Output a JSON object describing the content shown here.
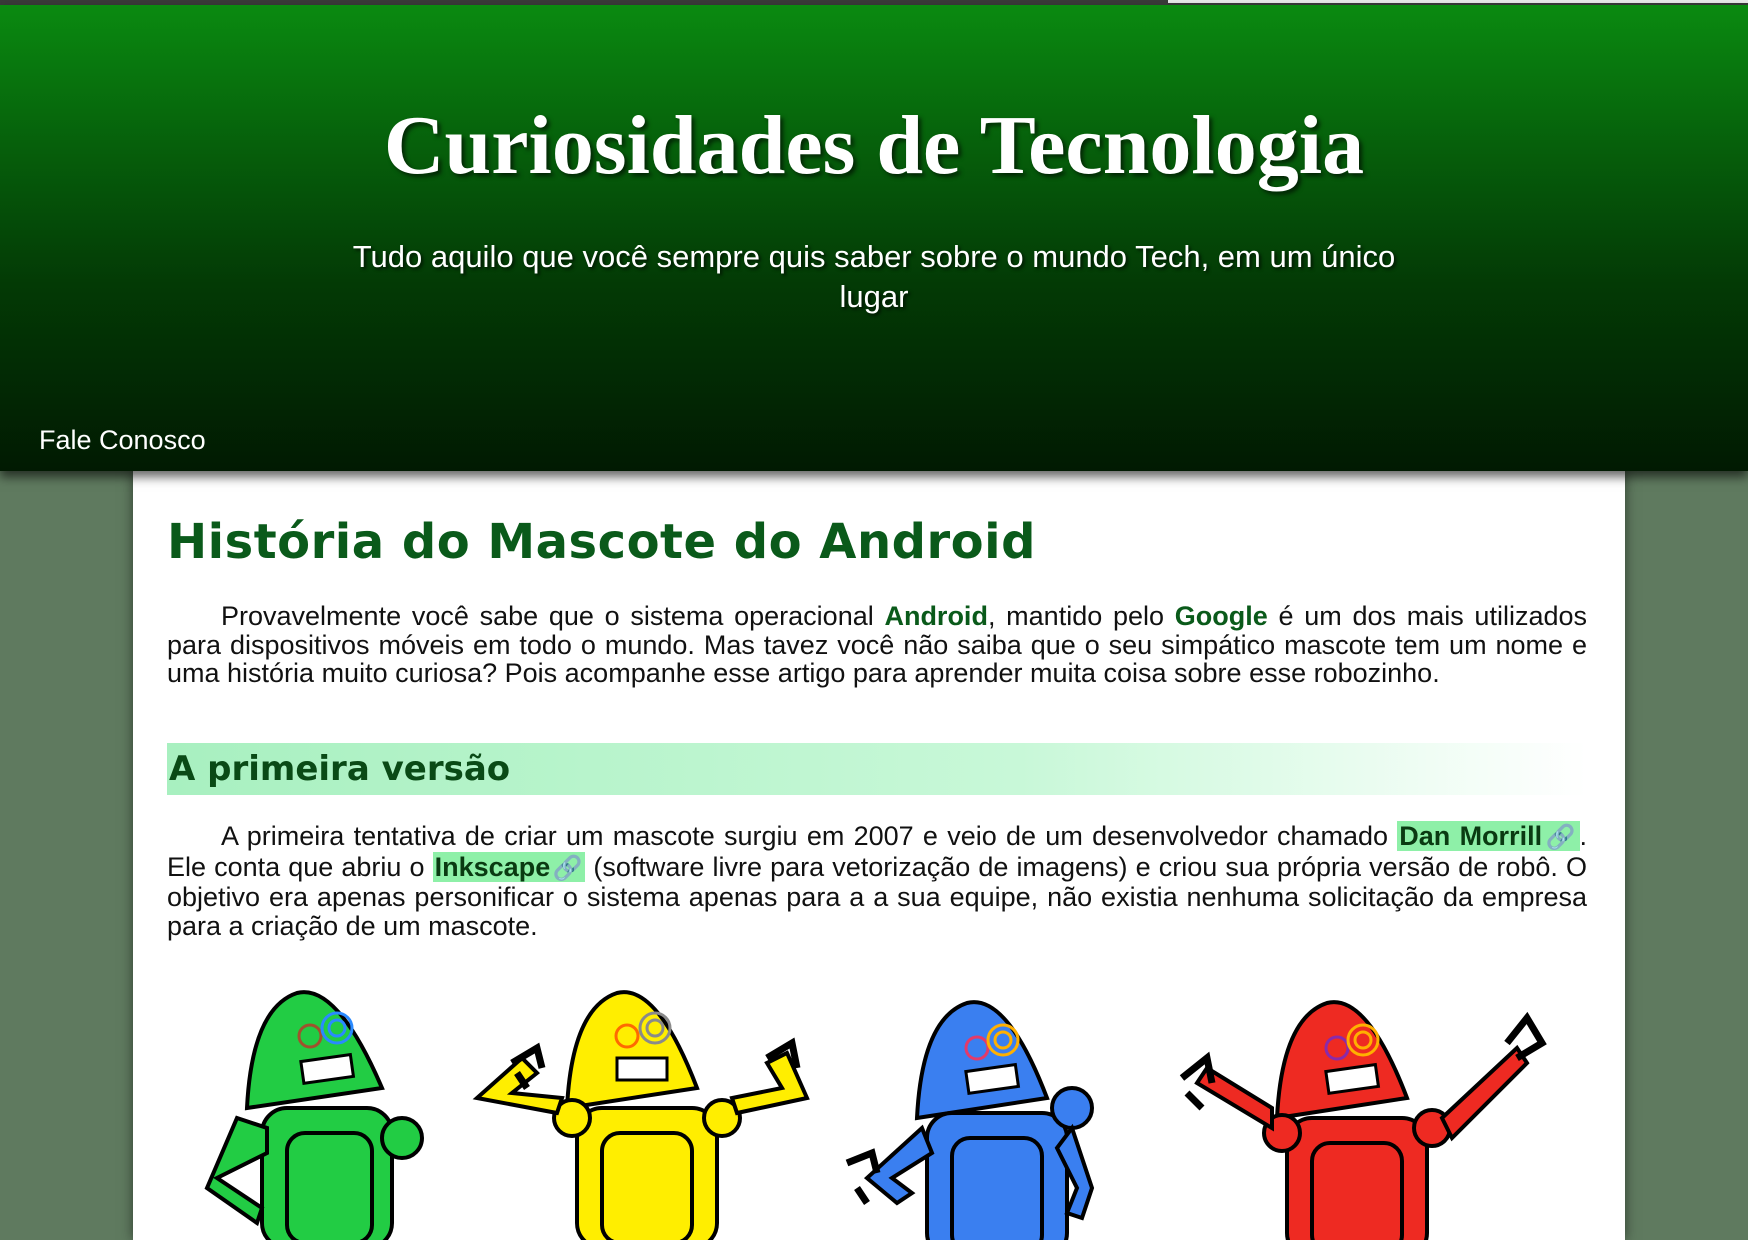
{
  "header": {
    "title": "Curiosidades de Tecnologia",
    "subtitle": "Tudo aquilo que você sempre quis saber sobre o mundo Tech, em um único lugar",
    "nav_link": "Fale Conosco"
  },
  "article": {
    "title": "História do Mascote do Android",
    "intro": {
      "part1": "Provavelmente você sabe que o sistema operacional ",
      "kw1": "Android",
      "part2": ", mantido pelo ",
      "kw2": "Google",
      "part3": " é um dos mais utilizados para dispositivos móveis em todo o mundo. Mas tavez você não saiba que o seu simpático mascote tem um nome e uma história muito curiosa? Pois acompanhe esse artigo para aprender muita coisa sobre esse robozinho."
    },
    "section_title": "A primeira versão",
    "section_para": {
      "part1": "A primeira tentativa de criar um mascote surgiu em 2007 e veio de um desenvolvedor chamado ",
      "link1": "Dan Morrill",
      "part2": ". Ele conta que abriu o ",
      "link2": "Inkscape",
      "part3": " (software livre para vetorização de imagens) e criou sua própria versão de robô. O objetivo era apenas personificar o sistema apenas para a a sua equipe, não existia nenhuma solicitação da empresa para a criação de um mascote."
    },
    "robot_colors": [
      "#22cc44",
      "#ffee00",
      "#3a7ff0",
      "#ee2a22"
    ]
  },
  "colors": {
    "accent": "#0a5a1a",
    "highlight": "#8ef0a8",
    "page_bg": "#5f7a5f"
  }
}
